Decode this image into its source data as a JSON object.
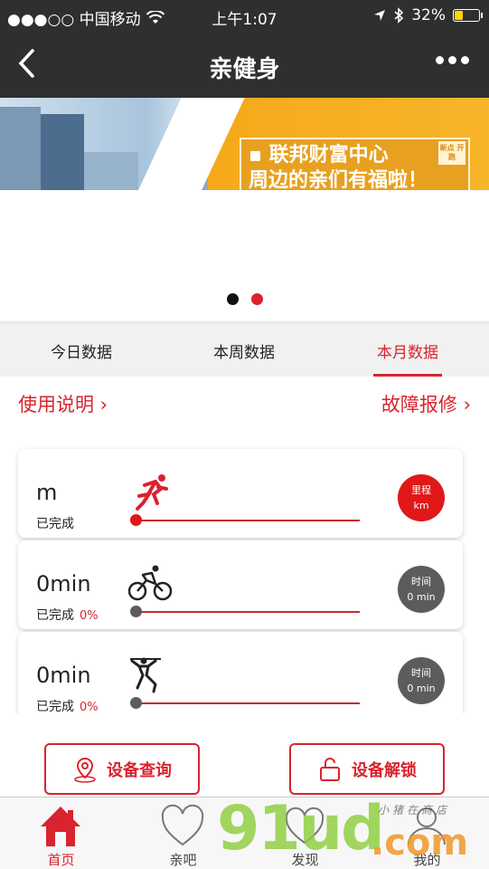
{
  "status_bar": {
    "carrier": "●●●○○ 中国移动",
    "time": "上午1:07",
    "battery": "32%"
  },
  "nav": {
    "title": "亲健身"
  },
  "banner": {
    "promo_line1": "▪ 联邦财富中心",
    "promo_line2": "周边的亲们有福啦！",
    "tag": "新点\n开跑",
    "active_dot": 1
  },
  "tabs": [
    {
      "label": "今日数据",
      "active": false
    },
    {
      "label": "本周数据",
      "active": false
    },
    {
      "label": "本月数据",
      "active": true
    }
  ],
  "links": {
    "instructions": "使用说明 ›",
    "repair": "故障报修 ›"
  },
  "cards": [
    {
      "value": "m",
      "done_label": "已完成",
      "percent": "",
      "icon": "running-icon",
      "badge_line1": "里程",
      "badge_line2": "km",
      "badge_color": "#e01818",
      "knob_color": "#e01818"
    },
    {
      "value": "0min",
      "done_label": "已完成",
      "percent": "0%",
      "icon": "cycling-icon",
      "badge_line1": "时间",
      "badge_line2": "0 min",
      "badge_color": "#5c5c5c",
      "knob_color": "#5c5c5c"
    },
    {
      "value": "0min",
      "done_label": "已完成",
      "percent": "0%",
      "icon": "weightlifting-icon",
      "badge_line1": "时间",
      "badge_line2": "0 min",
      "badge_color": "#5c5c5c",
      "knob_color": "#5c5c5c"
    }
  ],
  "actions": {
    "device_query": "设备查询",
    "device_unlock": "设备解锁"
  },
  "tabbar": [
    {
      "label": "首页",
      "icon": "home-icon",
      "active": true
    },
    {
      "label": "亲吧",
      "icon": "heart-icon",
      "active": false
    },
    {
      "label": "发现",
      "icon": "discover-icon",
      "active": false
    },
    {
      "label": "我的",
      "icon": "profile-icon",
      "active": false
    }
  ],
  "watermark": {
    "main": "91ud",
    "suffix": ".com",
    "small": "小猪在商店"
  },
  "colors": {
    "accent": "#d9232e",
    "navbar": "#2f2f2f",
    "banner_orange": "#f5a91a"
  }
}
